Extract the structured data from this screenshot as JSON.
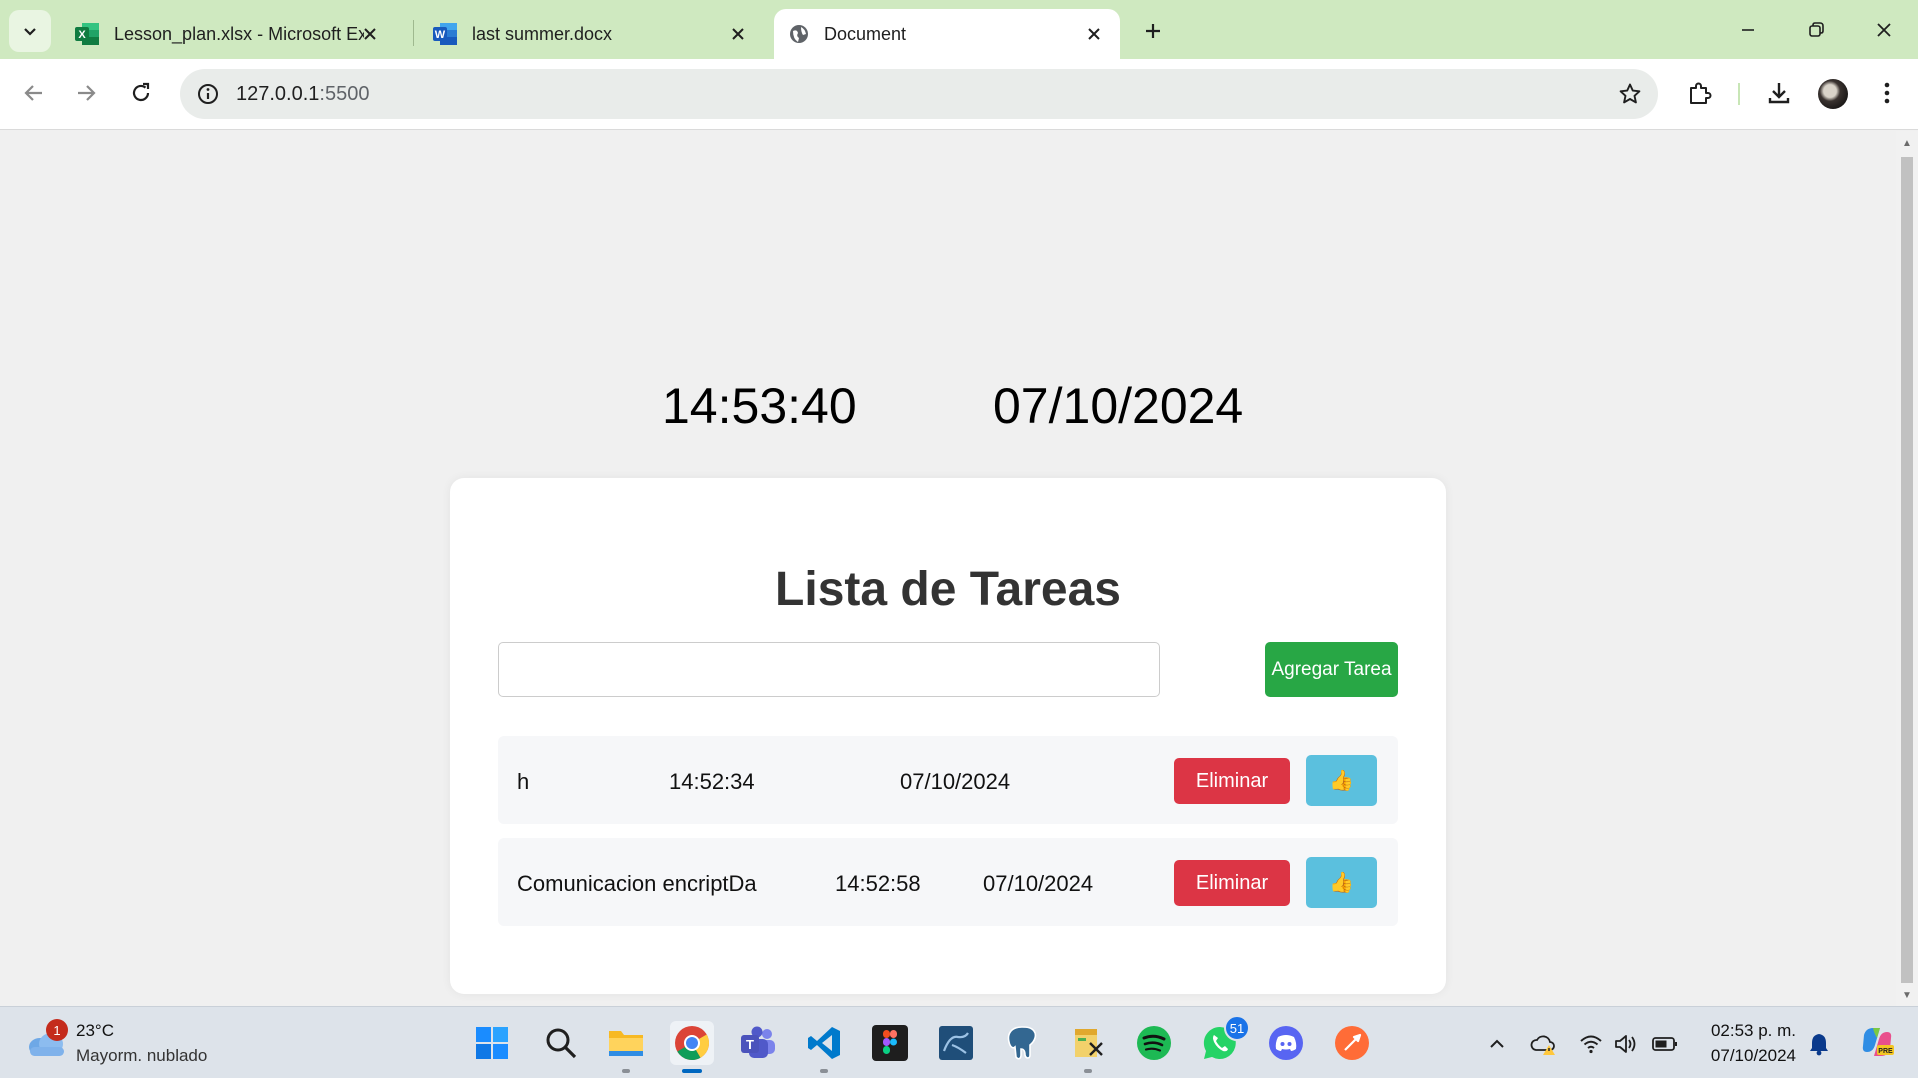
{
  "browser": {
    "tabs": [
      {
        "title": "Lesson_plan.xlsx - Microsoft Exc",
        "icon": "excel-icon",
        "active": false
      },
      {
        "title": "last summer.docx",
        "icon": "word-icon",
        "active": false
      },
      {
        "title": "Document",
        "icon": "globe-icon",
        "active": true
      }
    ],
    "url_host": "127.0.0.1",
    "url_port": ":5500"
  },
  "page": {
    "clock_time": "14:53:40",
    "clock_date": "07/10/2024",
    "title": "Lista de Tareas",
    "input_value": "",
    "add_button_label": "Agregar Tarea",
    "tasks": [
      {
        "name": "h",
        "time": "14:52:34",
        "date": "07/10/2024",
        "delete_label": "Eliminar",
        "like_label": "👍"
      },
      {
        "name": "Comunicacion encriptDa",
        "time": "14:52:58",
        "date": "07/10/2024",
        "delete_label": "Eliminar",
        "like_label": "👍"
      }
    ],
    "colors": {
      "add_button": "#28a745",
      "delete_button": "#dc3545",
      "like_button": "#5bc0de",
      "background": "#f0f0f0",
      "card": "#ffffff"
    }
  },
  "taskbar": {
    "weather_badge": "1",
    "weather_temp": "23°C",
    "weather_desc": "Mayorm. nublado",
    "apps": [
      "windows-start",
      "search",
      "file-explorer",
      "chrome",
      "teams",
      "vscode",
      "figma",
      "mysql-workbench",
      "postgresql",
      "app-installer",
      "spotify",
      "whatsapp",
      "discord",
      "postman"
    ],
    "whatsapp_badge": "51",
    "clock_time": "02:53 p. m.",
    "clock_date": "07/10/2024"
  }
}
